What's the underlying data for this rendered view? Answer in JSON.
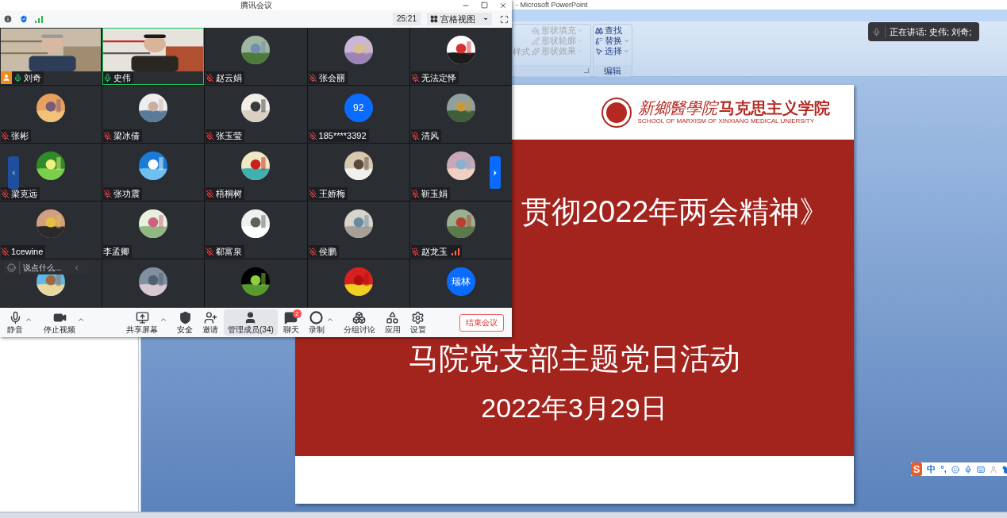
{
  "ppt": {
    "title": "- Microsoft PowerPoint",
    "ribbon": {
      "cut_label": "样式",
      "shape_items": [
        {
          "label": "形状填充",
          "disabled": true
        },
        {
          "label": "形状轮廓",
          "disabled": true
        },
        {
          "label": "形状效果",
          "disabled": true
        }
      ],
      "edit_group": {
        "title": "编辑",
        "items": [
          {
            "label": "查找",
            "caret": false
          },
          {
            "label": "替换",
            "caret": true
          },
          {
            "label": "选择",
            "caret": true
          }
        ]
      }
    },
    "slide": {
      "logo_calligraphy": "新鄉醫學院",
      "logo_name": "马克思主义学院",
      "logo_english": "SCHOOL OF MARXISM OF XINXIANG MEDICAL UNIERSITY",
      "title": "贯彻2022年两会精神》",
      "subtitle": "马院党支部主题党日活动",
      "date": "2022年3月29日"
    }
  },
  "speaking_toast": {
    "text": "正在讲话: 史伟; 刘奇;"
  },
  "ime_bar": {
    "items": [
      {
        "kind": "logo",
        "text": "S"
      },
      {
        "kind": "text",
        "text": "中"
      },
      {
        "kind": "text",
        "text": "°,"
      },
      {
        "kind": "emoji"
      },
      {
        "kind": "mic"
      },
      {
        "kind": "keyboard"
      },
      {
        "kind": "user"
      },
      {
        "kind": "shirt"
      }
    ]
  },
  "meeting": {
    "title": "腾讯会议",
    "timer": "25:21",
    "view_button": "宫格视图",
    "tiles": [
      {
        "kind": "video",
        "name": "刘奇",
        "has_mic": true,
        "muted": false,
        "host": true,
        "speaking": false,
        "signal": false
      },
      {
        "kind": "video",
        "name": "史伟",
        "has_mic": true,
        "muted": false,
        "host": false,
        "speaking": true,
        "signal": false
      },
      {
        "kind": "avatar",
        "name": "赵云娟",
        "has_mic": true,
        "muted": true,
        "host": false,
        "speaking": false,
        "signal": false
      },
      {
        "kind": "avatar",
        "name": "张会丽",
        "has_mic": true,
        "muted": true,
        "host": false,
        "speaking": false,
        "signal": false
      },
      {
        "kind": "avatar",
        "name": "无法定怿",
        "has_mic": true,
        "muted": true,
        "host": false,
        "speaking": false,
        "signal": false
      },
      {
        "kind": "avatar",
        "name": "张彬",
        "has_mic": true,
        "muted": true,
        "host": false,
        "speaking": false,
        "signal": false
      },
      {
        "kind": "avatar",
        "name": "梁冰倩",
        "has_mic": true,
        "muted": true,
        "host": false,
        "speaking": false,
        "signal": false
      },
      {
        "kind": "avatar",
        "name": "张玉莹",
        "has_mic": true,
        "muted": true,
        "host": false,
        "speaking": false,
        "signal": false
      },
      {
        "kind": "initial",
        "initial": "92",
        "name": "185****3392",
        "has_mic": true,
        "muted": true,
        "host": false,
        "speaking": false,
        "signal": false
      },
      {
        "kind": "avatar",
        "name": "清风",
        "has_mic": true,
        "muted": true,
        "host": false,
        "speaking": false,
        "signal": false
      },
      {
        "kind": "avatar",
        "name": "梁克远",
        "has_mic": true,
        "muted": true,
        "host": false,
        "speaking": false,
        "signal": false
      },
      {
        "kind": "avatar",
        "name": "张功震",
        "has_mic": true,
        "muted": true,
        "host": false,
        "speaking": false,
        "signal": false
      },
      {
        "kind": "avatar",
        "name": "梧桐树",
        "has_mic": true,
        "muted": true,
        "host": false,
        "speaking": false,
        "signal": false
      },
      {
        "kind": "avatar",
        "name": "王娇梅",
        "has_mic": true,
        "muted": true,
        "host": false,
        "speaking": false,
        "signal": false
      },
      {
        "kind": "avatar",
        "name": "靳玉娟",
        "has_mic": true,
        "muted": true,
        "host": false,
        "speaking": false,
        "signal": false
      },
      {
        "kind": "avatar",
        "name": "1cewine",
        "has_mic": true,
        "muted": true,
        "host": false,
        "speaking": false,
        "signal": false
      },
      {
        "kind": "avatar",
        "name": "李孟卿",
        "has_mic": false,
        "host": false,
        "speaking": false,
        "signal": false
      },
      {
        "kind": "avatar",
        "name": "郗富泉",
        "has_mic": true,
        "muted": true,
        "host": false,
        "speaking": false,
        "signal": false
      },
      {
        "kind": "avatar",
        "name": "侯鹏",
        "has_mic": true,
        "muted": true,
        "host": false,
        "speaking": false,
        "signal": false
      },
      {
        "kind": "avatar",
        "name": "赵龙玉",
        "has_mic": true,
        "muted": true,
        "host": false,
        "speaking": false,
        "signal": true
      },
      {
        "kind": "avatar",
        "speaking": false
      },
      {
        "kind": "avatar",
        "speaking": false
      },
      {
        "kind": "avatar",
        "speaking": false
      },
      {
        "kind": "avatar",
        "speaking": false
      },
      {
        "kind": "initial",
        "initial": "瑞林",
        "speaking": false
      }
    ],
    "pager": [
      {
        "kind": "prev",
        "disabled": true
      },
      {
        "kind": "next",
        "disabled": false
      }
    ],
    "chat_input": {
      "placeholder": "说点什么..."
    },
    "toolbar": {
      "left": [
        {
          "kind": "mic",
          "label": "静音",
          "caret": true,
          "selected": false
        },
        {
          "kind": "video",
          "label": "停止视频",
          "caret": true,
          "selected": false
        }
      ],
      "center": [
        {
          "kind": "share",
          "label": "共享屏幕",
          "caret": true,
          "selected": false
        },
        {
          "kind": "security",
          "label": "安全",
          "caret": false,
          "selected": false
        },
        {
          "kind": "invite",
          "label": "邀请",
          "caret": false,
          "selected": false
        },
        {
          "kind": "members",
          "label": "管理成员(34)",
          "caret": false,
          "selected": true
        },
        {
          "kind": "chat",
          "label": "聊天",
          "badge": "2",
          "caret": false,
          "selected": false
        },
        {
          "kind": "record",
          "label": "录制",
          "caret": true,
          "selected": false
        },
        {
          "kind": "breakout",
          "label": "分组讨论",
          "caret": false,
          "selected": false
        },
        {
          "kind": "apps",
          "label": "应用",
          "caret": false,
          "selected": false
        },
        {
          "kind": "settings",
          "label": "设置",
          "caret": false,
          "selected": false
        }
      ],
      "end_button": "结束会议"
    }
  }
}
